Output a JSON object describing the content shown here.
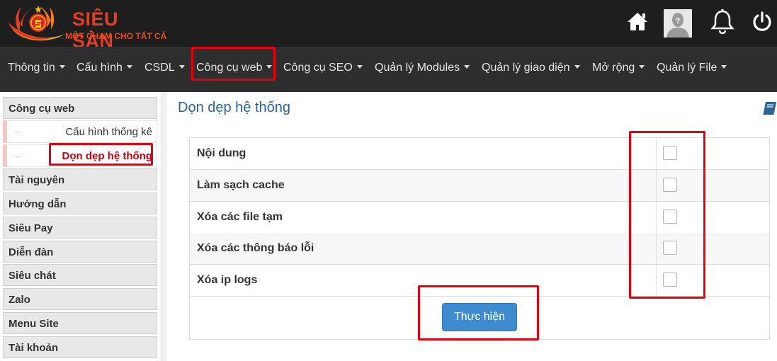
{
  "header": {
    "logo_title": "SIÊU SÀN",
    "logo_subtitle": "MỘT CHẠM CHO TẤT CẢ",
    "icons": [
      "home-icon",
      "avatar",
      "bell-icon",
      "power-icon"
    ]
  },
  "nav": {
    "items": [
      {
        "label": "Thông tin"
      },
      {
        "label": "Cấu hình"
      },
      {
        "label": "CSDL"
      },
      {
        "label": "Công cụ web"
      },
      {
        "label": "Công cụ SEO"
      },
      {
        "label": "Quản lý Modules"
      },
      {
        "label": "Quản lý giao diện"
      },
      {
        "label": "Mở rộng"
      },
      {
        "label": "Quản lý File"
      }
    ]
  },
  "sidebar": {
    "section_title": "Công cụ web",
    "sub_items": [
      {
        "label": "Cấu hình thống kê"
      },
      {
        "label": "Dọn dẹp hệ thống"
      }
    ],
    "categories": [
      {
        "label": "Tài nguyên"
      },
      {
        "label": "Hướng dẫn"
      },
      {
        "label": "Siêu Pay"
      },
      {
        "label": "Diễn đàn"
      },
      {
        "label": "Siêu chát"
      },
      {
        "label": "Zalo"
      },
      {
        "label": "Menu Site"
      },
      {
        "label": "Tài khoản"
      }
    ]
  },
  "main": {
    "title": "Dọn dẹp hệ thống",
    "rows": [
      {
        "label": "Nội dung",
        "checked": false
      },
      {
        "label": "Làm sạch cache",
        "checked": false
      },
      {
        "label": "Xóa các file tạm",
        "checked": false
      },
      {
        "label": "Xóa các thông báo lỗi",
        "checked": false
      },
      {
        "label": "Xóa ip logs",
        "checked": false
      }
    ],
    "submit_label": "Thực hiện"
  },
  "colors": {
    "topbar": "#1e1e1e",
    "navbar": "#2e2e2e",
    "highlight": "#e60012",
    "brand": "#e53d21",
    "title": "#2a6496",
    "button": "#3f8bd0"
  }
}
